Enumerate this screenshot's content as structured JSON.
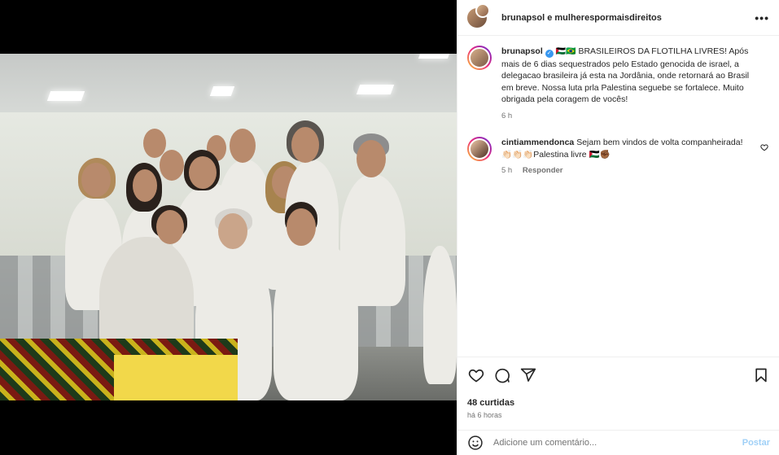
{
  "header": {
    "title": "brunapsol e mulherespormaisdireitos",
    "more_label": "•••"
  },
  "caption": {
    "username": "brunapsol",
    "verified_mark": "✓",
    "flags": "🇵🇸🇧🇷",
    "text": "BRASILEIROS DA FLOTILHA LIVRES! Após mais de 6 dias sequestrados pelo Estado genocida de israel, a delegacao brasileira já esta na Jordânia, onde retornará ao Brasil em breve. Nossa luta prla Palestina seguebe se fortalece. Muito obrigada pela coragem de vocês!",
    "time": "6 h"
  },
  "comment": {
    "username": "cintiammendonca",
    "text": "Sejam bem vindos de volta companheirada!",
    "text2": "👏🏻👏🏻👏🏻Palestina livre 🇵🇸✊🏾",
    "time": "5 h",
    "reply_label": "Responder"
  },
  "stats": {
    "likes": "48 curtidas",
    "time_ago": "há 6 horas"
  },
  "comment_box": {
    "placeholder": "Adicione um comentário...",
    "post_label": "Postar"
  },
  "media": {
    "avatar_tag": "👤"
  },
  "colors": {
    "accent": "#0095f6",
    "verified": "#3897f0",
    "muted": "#737373"
  }
}
